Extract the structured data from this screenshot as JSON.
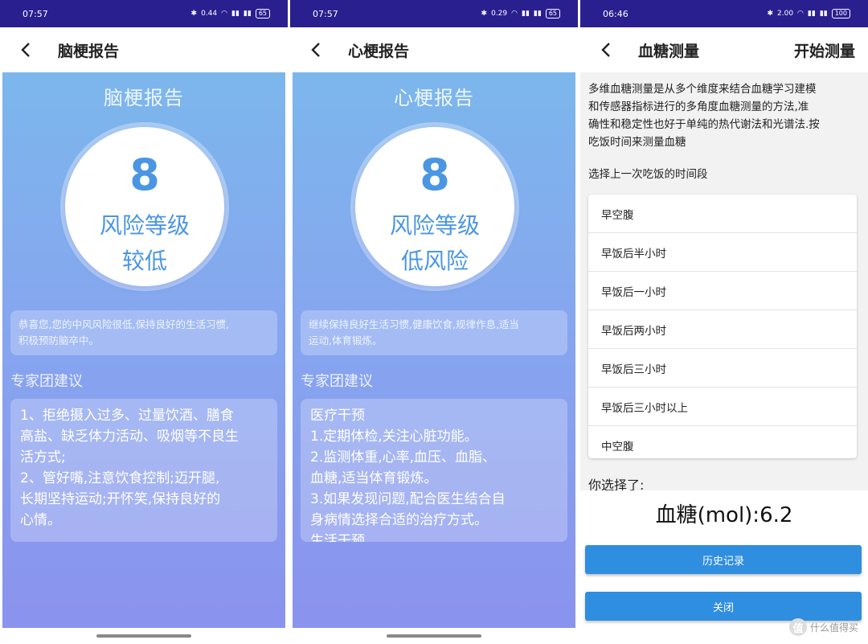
{
  "phones": [
    {
      "status": {
        "time": "07:57",
        "signal": "0.44",
        "battery": "65"
      },
      "header": {
        "title": "脑梗报告"
      },
      "report": {
        "title": "脑梗报告",
        "score": "8",
        "risk_label": "风险等级",
        "level": "较低",
        "notice": [
          "恭喜您,您的中风风险很低,保持良好的生活习惯,",
          "积极预防脑卒中。"
        ],
        "expert_title": "专家团建议",
        "advice": [
          "1、拒绝摄入过多、过量饮酒、膳食",
          "高盐、缺乏体力活动、吸烟等不良生",
          "活方式;",
          "2、管好嘴,注意饮食控制;迈开腿,",
          "长期坚持运动;开怀笑,保持良好的",
          "心情。"
        ]
      }
    },
    {
      "status": {
        "time": "07:57",
        "signal": "0.29",
        "battery": "65"
      },
      "header": {
        "title": "心梗报告"
      },
      "report": {
        "title": "心梗报告",
        "score": "8",
        "risk_label": "风险等级",
        "level": "低风险",
        "notice": [
          "继续保持良好生活习惯,健康饮食,规律作息,适当",
          "运动,体育锻炼。"
        ],
        "expert_title": "专家团建议",
        "advice": [
          "医疗干预",
          "1.定期体检,关注心脏功能。",
          "2.监测体重,心率,血压、血脂、",
          "血糖,适当体育锻炼。",
          "3.如果发现问题,配合医生结合自",
          "身病情选择合适的治疗方式。",
          "生活干预"
        ]
      }
    },
    {
      "status": {
        "time": "06:46",
        "signal": "2.00",
        "battery": "100"
      },
      "header": {
        "title": "血糖测量",
        "action": "开始测量"
      },
      "intro": [
        "多维血糖测量是从多个维度来结合血糖学习建模",
        "和传感器指标进行的多角度血糖测量的方法,准",
        "确性和稳定性也好于单纯的热代谢法和光谱法.按",
        "吃饭时间来测量血糖"
      ],
      "select_label": "选择上一次吃饭的时间段",
      "options": [
        "早空腹",
        "早饭后半小时",
        "早饭后一小时",
        "早饭后两小时",
        "早饭后三小时",
        "早饭后三小时以上",
        "中空腹"
      ],
      "chosen_label": "你选择了:",
      "glucose_text": "血糖(mol):6.2",
      "buttons": {
        "history": "历史记录",
        "close": "关闭"
      },
      "watermark": {
        "logo": "值",
        "text": "什么值得买"
      }
    }
  ]
}
